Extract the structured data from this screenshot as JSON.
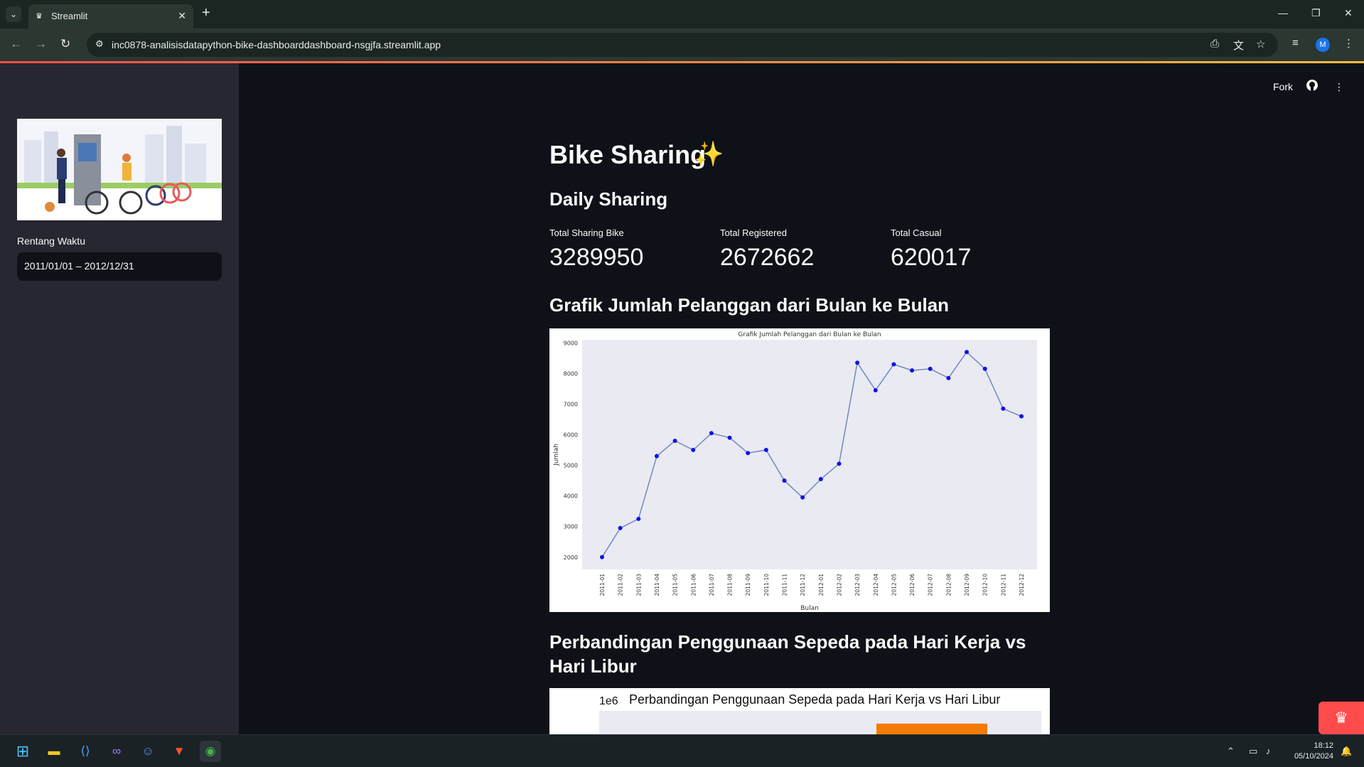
{
  "browser": {
    "tab_title": "Streamlit",
    "url": "inc0878-analisisdatapython-bike-dashboarddashboard-nsgjfa.streamlit.app",
    "profile_initial": "M"
  },
  "header": {
    "fork_label": "Fork"
  },
  "sidebar": {
    "range_label": "Rentang Waktu",
    "date_range_value": "2011/01/01 – 2012/12/31"
  },
  "main": {
    "title": "Bike Sharing",
    "title_emoji": "✨",
    "daily_heading": "Daily Sharing",
    "metrics": [
      {
        "label": "Total Sharing Bike",
        "value": "3289950"
      },
      {
        "label": "Total Registered",
        "value": "2672662"
      },
      {
        "label": "Total Casual",
        "value": "620017"
      }
    ],
    "chart1_heading": "Grafik Jumlah Pelanggan dari Bulan ke Bulan",
    "chart2_heading": "Perbandingan Penggunaan Sepeda pada Hari Kerja vs Hari Libur"
  },
  "chart_data": [
    {
      "type": "line",
      "title": "Grafik Jumlah Pelanggan dari Bulan ke Bulan",
      "xlabel": "Bulan",
      "ylabel": "Jumlah",
      "ylim": [
        1600,
        9100
      ],
      "yticks": [
        2000,
        3000,
        4000,
        5000,
        6000,
        7000,
        8000,
        9000
      ],
      "categories": [
        "2011-01",
        "2011-02",
        "2011-03",
        "2011-04",
        "2011-05",
        "2011-06",
        "2011-07",
        "2011-08",
        "2011-09",
        "2011-10",
        "2011-11",
        "2011-12",
        "2012-01",
        "2012-02",
        "2012-03",
        "2012-04",
        "2012-05",
        "2012-06",
        "2012-07",
        "2012-08",
        "2012-09",
        "2012-10",
        "2012-11",
        "2012-12"
      ],
      "values": [
        2000,
        2950,
        3250,
        5300,
        5800,
        5500,
        6050,
        5900,
        5400,
        5500,
        4500,
        3950,
        4550,
        5050,
        8350,
        7450,
        8300,
        8100,
        8150,
        7850,
        8700,
        8150,
        6850,
        6600
      ],
      "line_color": "#6f89be",
      "marker_color": "#1010ee",
      "plot_bg": "#eaeaf2",
      "grid": false,
      "legend": "none"
    },
    {
      "type": "bar",
      "title": "Perbandingan Penggunaan Sepeda pada Hari Kerja vs Hari Libur",
      "y_scale_label": "1e6",
      "bar_color": "#f47b00",
      "plot_bg": "#eaeaf2"
    }
  ],
  "taskbar": {
    "time": "18:12",
    "date": "05/10/2024",
    "apps": [
      "windows-start",
      "file-explorer",
      "vscode",
      "visual-studio",
      "discord",
      "brave",
      "chrome"
    ]
  }
}
